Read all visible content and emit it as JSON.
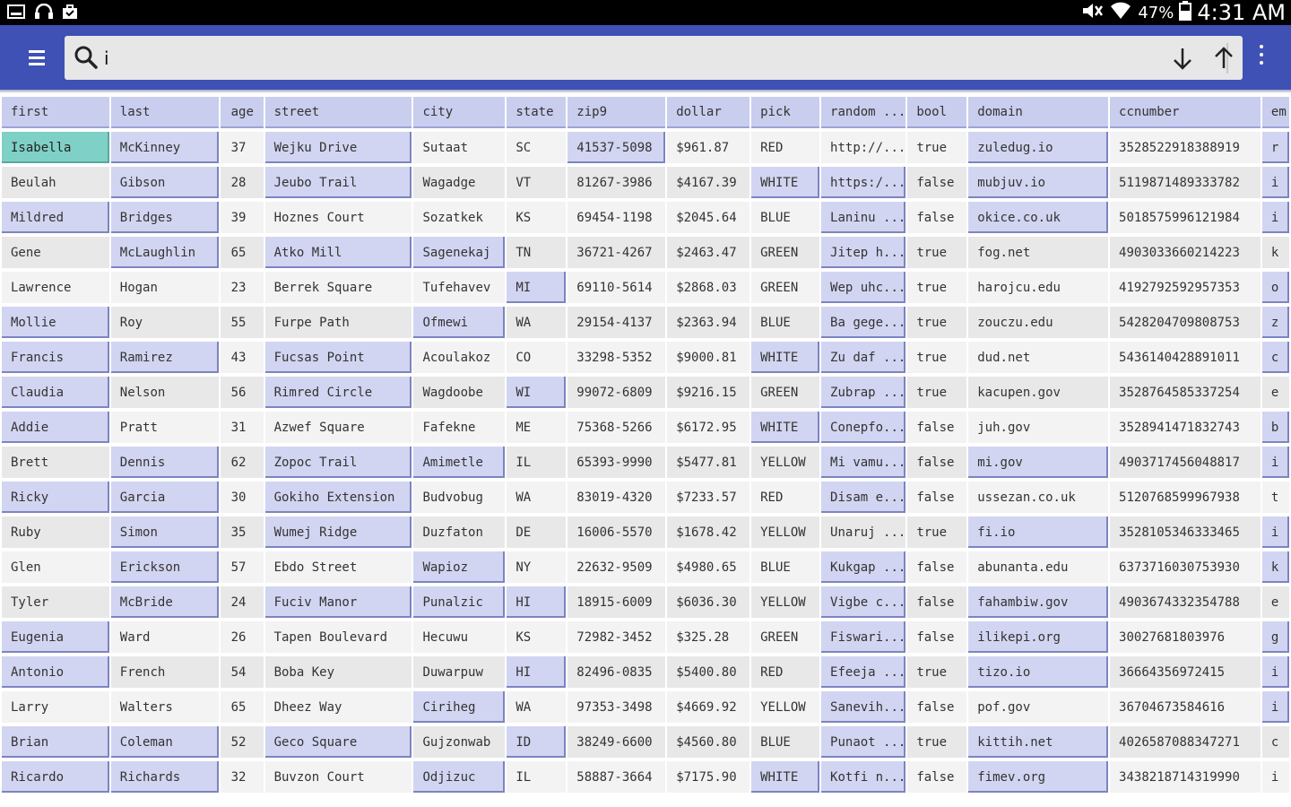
{
  "status_bar": {
    "battery": "47%",
    "time": "4:31 AM"
  },
  "search": {
    "value": "i",
    "placeholder": ""
  },
  "columns": [
    "first",
    "last",
    "age",
    "street",
    "city",
    "state",
    "zip9",
    "dollar",
    "pick",
    "random ...",
    "bool",
    "domain",
    "ccnumber",
    "em"
  ],
  "rows": [
    {
      "cells": [
        "Isabella",
        "McKinney",
        "37",
        "Wejku Drive",
        "Sutaat",
        "SC",
        "41537-5098",
        "$961.87",
        "RED",
        "http://...",
        "true",
        "zuledug.io",
        "3528522918388919",
        "r"
      ],
      "hl": [
        0,
        1,
        3,
        6,
        11,
        13
      ],
      "sel": 0
    },
    {
      "cells": [
        "Beulah",
        "Gibson",
        "28",
        "Jeubo Trail",
        "Wagadge",
        "VT",
        "81267-3986",
        "$4167.39",
        "WHITE",
        "https:/...",
        "false",
        "mubjuv.io",
        "5119871489333782",
        "i"
      ],
      "hl": [
        1,
        3,
        8,
        9,
        11,
        13
      ]
    },
    {
      "cells": [
        "Mildred",
        "Bridges",
        "39",
        "Hoznes Court",
        "Sozatkek",
        "KS",
        "69454-1198",
        "$2045.64",
        "BLUE",
        "Laninu ...",
        "false",
        "okice.co.uk",
        "5018575996121984",
        "i"
      ],
      "hl": [
        0,
        1,
        9,
        11,
        13
      ]
    },
    {
      "cells": [
        "Gene",
        "McLaughlin",
        "65",
        "Atko Mill",
        "Sagenekaj",
        "TN",
        "36721-4267",
        "$2463.47",
        "GREEN",
        "Jitep h...",
        "true",
        "fog.net",
        "4903033660214223",
        "k"
      ],
      "hl": [
        1,
        3,
        4,
        9
      ]
    },
    {
      "cells": [
        "Lawrence",
        "Hogan",
        "23",
        "Berrek Square",
        "Tufehavev",
        "MI",
        "69110-5614",
        "$2868.03",
        "GREEN",
        "Wep uhc...",
        "true",
        "harojcu.edu",
        "4192792592957353",
        "o"
      ],
      "hl": [
        5,
        9,
        13
      ]
    },
    {
      "cells": [
        "Mollie",
        "Roy",
        "55",
        "Furpe Path",
        "Ofmewi",
        "WA",
        "29154-4137",
        "$2363.94",
        "BLUE",
        "Ba gege...",
        "true",
        "zouczu.edu",
        "5428204709808753",
        "z"
      ],
      "hl": [
        0,
        4,
        9,
        13
      ]
    },
    {
      "cells": [
        "Francis",
        "Ramirez",
        "43",
        "Fucsas Point",
        "Acoulakoz",
        "CO",
        "33298-5352",
        "$9000.81",
        "WHITE",
        "Zu daf ...",
        "true",
        "dud.net",
        "5436140428891011",
        "c"
      ],
      "hl": [
        0,
        1,
        3,
        8,
        9,
        13
      ]
    },
    {
      "cells": [
        "Claudia",
        "Nelson",
        "56",
        "Rimred Circle",
        "Wagdoobe",
        "WI",
        "99072-6809",
        "$9216.15",
        "GREEN",
        "Zubrap ...",
        "true",
        "kacupen.gov",
        "3528764585337254",
        "e"
      ],
      "hl": [
        0,
        3,
        5,
        9
      ]
    },
    {
      "cells": [
        "Addie",
        "Pratt",
        "31",
        "Azwef Square",
        "Fafekne",
        "ME",
        "75368-5266",
        "$6172.95",
        "WHITE",
        "Conepfo...",
        "false",
        "juh.gov",
        "3528941471832743",
        "b"
      ],
      "hl": [
        0,
        8,
        9,
        13
      ]
    },
    {
      "cells": [
        "Brett",
        "Dennis",
        "62",
        "Zopoc Trail",
        "Amimetle",
        "IL",
        "65393-9990",
        "$5477.81",
        "YELLOW",
        "Mi vamu...",
        "false",
        "mi.gov",
        "4903717456048817",
        "i"
      ],
      "hl": [
        1,
        3,
        4,
        9,
        11,
        13
      ]
    },
    {
      "cells": [
        "Ricky",
        "Garcia",
        "30",
        "Gokiho Extension",
        "Budvobug",
        "WA",
        "83019-4320",
        "$7233.57",
        "RED",
        "Disam e...",
        "false",
        "ussezan.co.uk",
        "5120768599967938",
        "t"
      ],
      "hl": [
        0,
        1,
        3,
        9
      ]
    },
    {
      "cells": [
        "Ruby",
        "Simon",
        "35",
        "Wumej Ridge",
        "Duzfaton",
        "DE",
        "16006-5570",
        "$1678.42",
        "YELLOW",
        "Unaruj ...",
        "true",
        "fi.io",
        "3528105346333465",
        "i"
      ],
      "hl": [
        1,
        3,
        11,
        13
      ]
    },
    {
      "cells": [
        "Glen",
        "Erickson",
        "57",
        "Ebdo Street",
        "Wapioz",
        "NY",
        "22632-9509",
        "$4980.65",
        "BLUE",
        "Kukgap ...",
        "false",
        "abunanta.edu",
        "6373716030753930",
        "k"
      ],
      "hl": [
        1,
        4,
        9,
        13
      ]
    },
    {
      "cells": [
        "Tyler",
        "McBride",
        "24",
        "Fuciv Manor",
        "Punalzic",
        "HI",
        "18915-6009",
        "$6036.30",
        "YELLOW",
        "Vigbe c...",
        "false",
        "fahambiw.gov",
        "4903674332354788",
        "e"
      ],
      "hl": [
        1,
        3,
        4,
        5,
        9,
        11
      ]
    },
    {
      "cells": [
        "Eugenia",
        "Ward",
        "26",
        "Tapen Boulevard",
        "Hecuwu",
        "KS",
        "72982-3452",
        "$325.28",
        "GREEN",
        "Fiswari...",
        "false",
        "ilikepi.org",
        "30027681803976",
        "g"
      ],
      "hl": [
        0,
        9,
        11,
        13
      ]
    },
    {
      "cells": [
        "Antonio",
        "French",
        "54",
        "Boba Key",
        "Duwarpuw",
        "HI",
        "82496-0835",
        "$5400.80",
        "RED",
        "Efeeja ...",
        "true",
        "tizo.io",
        "36664356972415",
        "i"
      ],
      "hl": [
        0,
        5,
        9,
        11,
        13
      ]
    },
    {
      "cells": [
        "Larry",
        "Walters",
        "65",
        "Dheez Way",
        "Ciriheg",
        "WA",
        "97353-3498",
        "$4669.92",
        "YELLOW",
        "Sanevih...",
        "false",
        "pof.gov",
        "36704673584616",
        "i"
      ],
      "hl": [
        4,
        9,
        13
      ]
    },
    {
      "cells": [
        "Brian",
        "Coleman",
        "52",
        "Geco Square",
        "Gujzonwab",
        "ID",
        "38249-6600",
        "$4560.80",
        "BLUE",
        "Punaot ...",
        "true",
        "kittih.net",
        "4026587088347271",
        "c"
      ],
      "hl": [
        0,
        1,
        3,
        5,
        9,
        11
      ]
    },
    {
      "cells": [
        "Ricardo",
        "Richards",
        "32",
        "Buvzon Court",
        "Odjizuc",
        "IL",
        "58887-3664",
        "$7175.90",
        "WHITE",
        "Kotfi n...",
        "false",
        "fimev.org",
        "3438218714319990",
        "i"
      ],
      "hl": [
        0,
        1,
        4,
        8,
        9,
        11
      ]
    }
  ]
}
